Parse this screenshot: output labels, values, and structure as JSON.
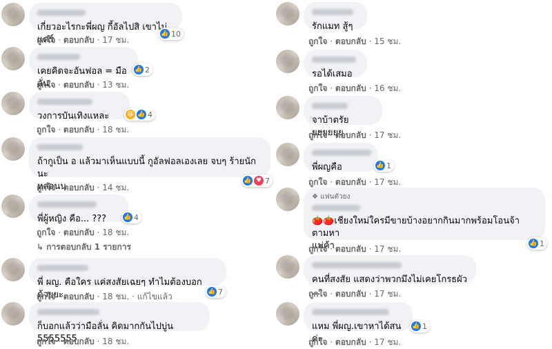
{
  "labels": {
    "like": "ถูกใจ",
    "reply": "ตอบกลับ",
    "edited": "แก้ไขแล้ว",
    "sep": "·"
  },
  "left": [
    {
      "text": "เกี่ยวอะไรกะพี่ผญ กี้อัลไปสิ เขาไม่แคร์",
      "time": "17 ชม.",
      "reactions": [
        "like"
      ],
      "count": "10"
    },
    {
      "text": "เคยคิดจะอันฟอล = มือลั่น",
      "time": "13 ชม.",
      "reactions": [
        "like"
      ],
      "count": "2"
    },
    {
      "text": "วงการบันเทิงแหละ",
      "time": "18 ชม.",
      "reactions": [
        "haha",
        "like"
      ],
      "count": "4"
    },
    {
      "text": "ถ้ากูเป็น อ แล้วมาเห็นแบบนี้ กูอัลฟอลเองเลย จบๆ ร้ายนักนะ\nหล่อนน",
      "time": "14 ชม.",
      "reactions": [
        "like",
        "love"
      ],
      "count": "7"
    },
    {
      "text": "พี่ผู้หญิง คือ... ???",
      "time": "18 ชม.",
      "reactions": [
        "like"
      ],
      "count": "4",
      "replies": "↳ การตอบกลับ 1 รายการ"
    },
    {
      "text": "พี่ ผญ. คือใคร แค่สงสัยเฉยๆ ทำไมต้องบอกด้วยยะ",
      "time": "18 ชม.",
      "reactions": [
        "like"
      ],
      "count": "7"
    },
    {
      "text": "ก็บอกแล้วว่ามือลั่น คิดมากกันไปบู่น 5555555",
      "time": "18 ชม.",
      "edited": true
    }
  ],
  "right": [
    {
      "text": "รักแมท สู้ๆ",
      "time": "15 ชม."
    },
    {
      "text": "รอได้เสมอ",
      "time": "16 ชม."
    },
    {
      "text": "จาบ้าตรัยยยยยยย",
      "time": "17 ชม."
    },
    {
      "text": "พี่ผญคือ",
      "time": "17 ชม.",
      "reactions": [
        "like"
      ],
      "count": "1"
    },
    {
      "text": "🍅🍅เชียงใหม่ใครมีขายบ้างอยากกินมากพร้อมโอนจ้า ตามหา\nแม่ค้า",
      "time": "17 ชม.",
      "badge": "❖ แฟนตัวยง",
      "reactions": [
        "like"
      ],
      "count": "1"
    },
    {
      "text": "คนที่สงสัย แสดงว่าพวกมึงไม่เคยโกรธผัว ...",
      "time": "17 ชม."
    },
    {
      "text": "แหม พี่ผญ.เขาหาได้สนค่ะ",
      "time": "17 ชม.",
      "reactions": [
        "like"
      ],
      "count": "1"
    }
  ]
}
